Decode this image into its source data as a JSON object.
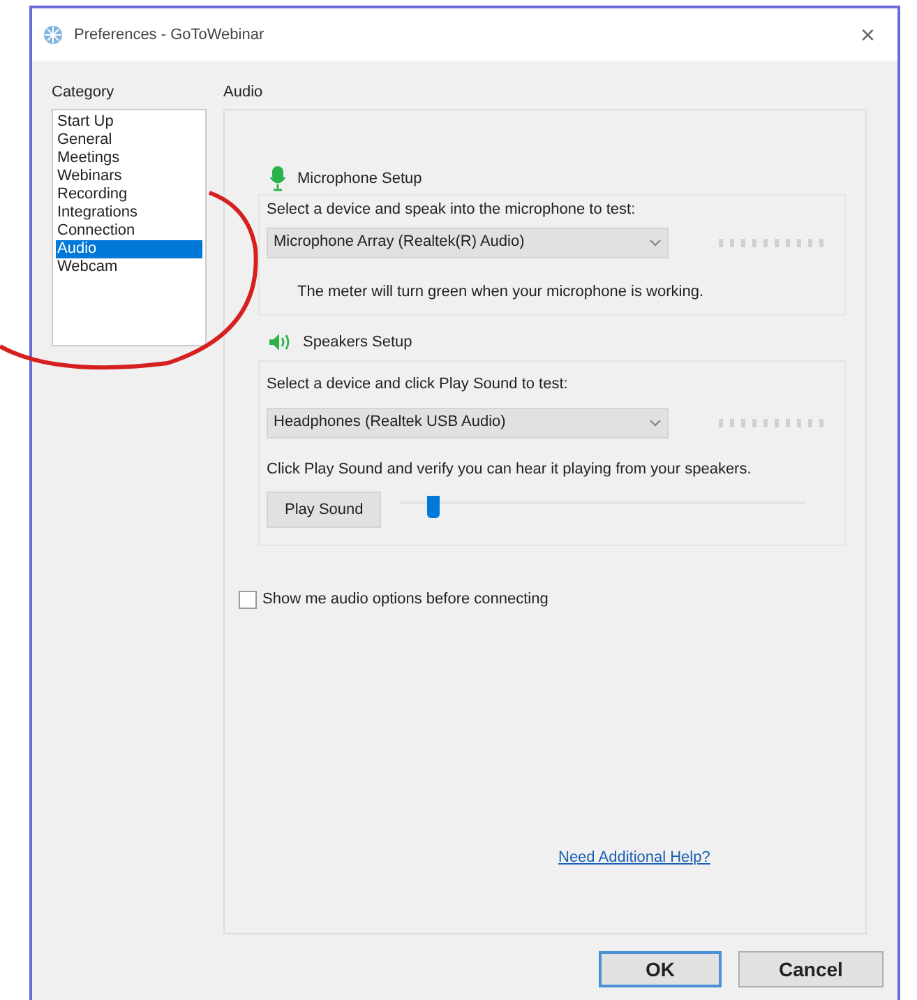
{
  "window": {
    "title": "Preferences - GoToWebinar",
    "close": "×"
  },
  "category": {
    "label": "Category",
    "items": [
      {
        "label": "Start Up",
        "selected": false
      },
      {
        "label": "General",
        "selected": false
      },
      {
        "label": "Meetings",
        "selected": false
      },
      {
        "label": "Webinars",
        "selected": false
      },
      {
        "label": "Recording",
        "selected": false
      },
      {
        "label": "Integrations",
        "selected": false
      },
      {
        "label": "Connection",
        "selected": false
      },
      {
        "label": "Audio",
        "selected": true
      },
      {
        "label": "Webcam",
        "selected": false
      }
    ]
  },
  "panel": {
    "title": "Audio",
    "microphone": {
      "heading": "Microphone Setup",
      "instruction": "Select a device and speak into the microphone to test:",
      "device": "Microphone Array (Realtek(R) Audio)",
      "note": "The meter will turn green when your microphone is working."
    },
    "speakers": {
      "heading": "Speakers Setup",
      "instruction": "Select a device and click Play Sound to test:",
      "device": "Headphones (Realtek USB Audio)",
      "note": "Click Play Sound and verify you can hear it playing from your speakers.",
      "play_button": "Play Sound",
      "volume": {
        "level": 0.08
      }
    },
    "show_options": {
      "label": "Show me audio options before connecting",
      "checked": false
    },
    "help_link": "Need Additional Help?"
  },
  "buttons": [
    {
      "label": "OK",
      "default": true
    },
    {
      "label": "Cancel",
      "default": false
    }
  ]
}
